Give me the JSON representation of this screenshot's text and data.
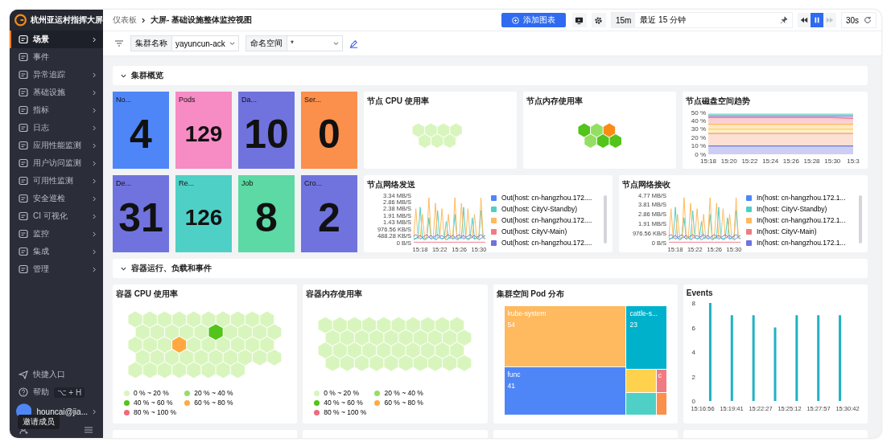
{
  "sidebar": {
    "title": "杭州亚运村指挥大屏",
    "items": [
      {
        "label": "场景",
        "selected": true,
        "submenu": true
      },
      {
        "label": "事件",
        "selected": false,
        "submenu": false
      },
      {
        "label": "异常追踪",
        "selected": false,
        "submenu": true
      },
      {
        "label": "基础设施",
        "selected": false,
        "submenu": true
      },
      {
        "label": "指标",
        "selected": false,
        "submenu": true
      },
      {
        "label": "日志",
        "selected": false,
        "submenu": true
      },
      {
        "label": "应用性能监测",
        "selected": false,
        "submenu": true
      },
      {
        "label": "用户访问监测",
        "selected": false,
        "submenu": true
      },
      {
        "label": "可用性监测",
        "selected": false,
        "submenu": true
      },
      {
        "label": "安全巡检",
        "selected": false,
        "submenu": true
      },
      {
        "label": "CI 可视化",
        "selected": false,
        "submenu": true
      },
      {
        "label": "监控",
        "selected": false,
        "submenu": true
      },
      {
        "label": "集成",
        "selected": false,
        "submenu": true
      },
      {
        "label": "管理",
        "selected": false,
        "submenu": true
      }
    ],
    "shortcut": "快捷入口",
    "help": "帮助",
    "help_keys": "⌥ + H",
    "user": "houncai@jia...",
    "tooltip": "邀请成员"
  },
  "header": {
    "breadcrumb": "仪表板",
    "title": "大屏- 基础设施整体监控视图",
    "add_button": "添加图表",
    "range_short": "15m",
    "range": "最近 15 分钟",
    "playback": [
      {
        "kind": "rewind",
        "selected": false,
        "disabled": false
      },
      {
        "kind": "pause",
        "selected": true,
        "disabled": false
      },
      {
        "kind": "forward",
        "selected": false,
        "disabled": true
      }
    ],
    "interval": "30s"
  },
  "filters": [
    {
      "label": "集群名称",
      "value": "yayuncun-ack"
    },
    {
      "label": "命名空间",
      "value": "*"
    }
  ],
  "sections": [
    {
      "title": "集群概览",
      "expanded": true
    },
    {
      "title": "容器运行、负载和事件",
      "expanded": true
    }
  ],
  "stats": [
    {
      "label": "No...",
      "value": "4",
      "color": "#4e86f8"
    },
    {
      "label": "Pods",
      "value": "129",
      "color": "#f78bc4"
    },
    {
      "label": "Da...",
      "value": "10",
      "color": "#7073de"
    },
    {
      "label": "Ser...",
      "value": "0",
      "color": "#fb8f4c"
    },
    {
      "label": "De...",
      "value": "31",
      "color": "#7073de"
    },
    {
      "label": "Re...",
      "value": "126",
      "color": "#4fd0c6"
    },
    {
      "label": "Job",
      "value": "8",
      "color": "#5cd9a4"
    },
    {
      "label": "Cro...",
      "value": "2",
      "color": "#7073de"
    }
  ],
  "node_cpu": {
    "title": "节点 CPU 使用率",
    "hexes": [
      {
        "color": "#d9f5be"
      },
      {
        "color": "#d9f5be"
      },
      {
        "color": "#d9f5be"
      },
      {
        "color": "#d9f5be"
      },
      {
        "color": "#d9f5be"
      },
      {
        "color": "#d9f5be"
      },
      {
        "color": "#d9f5be"
      }
    ]
  },
  "node_memory": {
    "title": "节点内存使用率",
    "hexes": [
      {
        "color": "#52c41a"
      },
      {
        "color": "#95de64"
      },
      {
        "color": "#fa8c16"
      },
      {
        "color": "#95de64"
      },
      {
        "color": "#52c41a"
      },
      {
        "color": "#52c41a"
      }
    ]
  },
  "disk_trend": {
    "title": "节点磁盘空间趋势",
    "chart_data": {
      "type": "area",
      "categories": [
        "15:18",
        "15:20",
        "15:22",
        "15:24",
        "15:26",
        "15:28",
        "15:30",
        "15:3"
      ],
      "ylim": [
        0,
        50
      ],
      "yticks": [
        {
          "value": 0,
          "label": "0 %"
        },
        {
          "value": 10,
          "label": "10 %"
        },
        {
          "value": 20,
          "label": "20 %"
        },
        {
          "value": 30,
          "label": "30 %"
        },
        {
          "value": 40,
          "label": "40 %"
        },
        {
          "value": 50,
          "label": "50 %"
        }
      ],
      "series": [
        {
          "color": "#6fd6c8",
          "values": [
            48,
            48,
            48,
            48,
            48,
            48,
            48,
            48
          ]
        },
        {
          "color": "#9a8fe2",
          "values": [
            46,
            46,
            46,
            46,
            46,
            46,
            46,
            46
          ]
        },
        {
          "color": "#f07c82",
          "values": [
            44,
            44,
            44,
            44,
            44,
            44,
            44,
            43
          ]
        },
        {
          "color": "#ffb95e",
          "values": [
            36,
            36,
            36,
            36,
            36,
            36,
            36,
            36
          ]
        },
        {
          "color": "#ffd666",
          "values": [
            30,
            30,
            30,
            30,
            30,
            30,
            30,
            30
          ]
        },
        {
          "color": "#f4a582",
          "values": [
            25,
            25,
            25,
            25,
            25,
            25,
            25,
            25
          ]
        },
        {
          "color": "#6f73df",
          "values": [
            10,
            10,
            10,
            10,
            10,
            10,
            10,
            10
          ]
        }
      ]
    }
  },
  "net_send": {
    "title": "节点网络发送",
    "y_labels": [
      "3.34 MB/S",
      "2.86 MB/S",
      "2.38 MB/S",
      "1.91 MB/S",
      "1.43 MB/S",
      "976.56 KB/S",
      "488.28 KB/S",
      "0 B/S"
    ],
    "x_labels": [
      "15:18",
      "15:22",
      "15:26",
      "15:30"
    ],
    "legend": [
      {
        "name": "Out(host: cn-hangzhou.172....",
        "color": "#4e86f8"
      },
      {
        "name": "Out(host: CityV-Standby)",
        "color": "#4fd0c6"
      },
      {
        "name": "Out(host: cn-hangzhou.172....",
        "color": "#ffb95e"
      },
      {
        "name": "Out(host: CityV-Main)",
        "color": "#f07c82"
      },
      {
        "name": "Out(host: cn-hangzhou.172....",
        "color": "#6f73df"
      }
    ]
  },
  "net_receive": {
    "title": "节点网络接收",
    "y_labels": [
      "4.77 MB/S",
      "3.81 MB/S",
      "2.86 MB/S",
      "1.91 MB/S",
      "976.56 KB/S",
      "0 B/S"
    ],
    "x_labels": [
      "15:18",
      "15:22",
      "15:26",
      "15:30"
    ],
    "legend": [
      {
        "name": "In(host: cn-hangzhou.172.1...",
        "color": "#4e86f8"
      },
      {
        "name": "In(host: CityV-Standby)",
        "color": "#4fd0c6"
      },
      {
        "name": "In(host: cn-hangzhou.172.1...",
        "color": "#ffb95e"
      },
      {
        "name": "In(host: CityV-Main)",
        "color": "#f07c82"
      },
      {
        "name": "In(host: cn-hangzhou.172.1...",
        "color": "#6f73df"
      }
    ]
  },
  "container_cpu": {
    "title": "容器 CPU 使用率",
    "hexes": [
      {
        "color": "#d9f5be"
      },
      {
        "color": "#d9f5be"
      },
      {
        "color": "#d9f5be"
      },
      {
        "color": "#d9f5be"
      },
      {
        "color": "#d9f5be"
      },
      {
        "color": "#d9f5be"
      },
      {
        "color": "#d9f5be"
      },
      {
        "color": "#d9f5be"
      },
      {
        "color": "#d9f5be"
      },
      {
        "color": "#d9f5be"
      },
      {
        "color": "#d9f5be"
      },
      {
        "color": "#d9f5be"
      },
      {
        "color": "#d9f5be"
      },
      {
        "color": "#d9f5be"
      },
      {
        "color": "#d9f5be"
      },
      {
        "color": "#52c41a"
      },
      {
        "color": "#d9f5be"
      },
      {
        "color": "#d9f5be"
      },
      {
        "color": "#d9f5be"
      },
      {
        "color": "#d9f5be"
      },
      {
        "color": "#d9f5be"
      },
      {
        "color": "#d9f5be"
      },
      {
        "color": "#d9f5be"
      },
      {
        "color": "#ffa940"
      },
      {
        "color": "#d9f5be"
      },
      {
        "color": "#d9f5be"
      },
      {
        "color": "#d9f5be"
      },
      {
        "color": "#d9f5be"
      },
      {
        "color": "#d9f5be"
      },
      {
        "color": "#d9f5be"
      },
      {
        "color": "#d9f5be"
      },
      {
        "color": "#d9f5be"
      },
      {
        "color": "#d9f5be"
      },
      {
        "color": "#d9f5be"
      },
      {
        "color": "#d9f5be"
      },
      {
        "color": "#d9f5be"
      },
      {
        "color": "#d9f5be"
      },
      {
        "color": "#d9f5be"
      },
      {
        "color": "#d9f5be"
      },
      {
        "color": "#d9f5be"
      },
      {
        "color": "#d9f5be"
      },
      {
        "color": "#d9f5be"
      },
      {
        "color": "#d9f5be"
      },
      {
        "color": "#d9f5be"
      },
      {
        "color": "#d9f5be"
      },
      {
        "color": "#d9f5be"
      },
      {
        "color": "#d9f5be"
      },
      {
        "color": "#d9f5be"
      }
    ],
    "legend": [
      {
        "label": "0 % ~ 20 %",
        "color": "#d9f5be"
      },
      {
        "label": "20 % ~ 40 %",
        "color": "#95de64"
      },
      {
        "label": "40 % ~ 60 %",
        "color": "#52c41a"
      },
      {
        "label": "60 % ~ 80 %",
        "color": "#ffa940"
      },
      {
        "label": "80 % ~ 100 %",
        "color": "#f06a7d"
      }
    ]
  },
  "container_memory": {
    "title": "容器内存使用率",
    "hexes": [
      {
        "color": "#d9f5be"
      },
      {
        "color": "#d9f5be"
      },
      {
        "color": "#d9f5be"
      },
      {
        "color": "#d9f5be"
      },
      {
        "color": "#d9f5be"
      },
      {
        "color": "#d9f5be"
      },
      {
        "color": "#d9f5be"
      },
      {
        "color": "#d9f5be"
      },
      {
        "color": "#d9f5be"
      },
      {
        "color": "#d9f5be"
      },
      {
        "color": "#d9f5be"
      },
      {
        "color": "#d9f5be"
      },
      {
        "color": "#d9f5be"
      },
      {
        "color": "#d9f5be"
      },
      {
        "color": "#d9f5be"
      },
      {
        "color": "#d9f5be"
      },
      {
        "color": "#d9f5be"
      },
      {
        "color": "#d9f5be"
      },
      {
        "color": "#d9f5be"
      },
      {
        "color": "#d9f5be"
      },
      {
        "color": "#d9f5be"
      },
      {
        "color": "#d9f5be"
      },
      {
        "color": "#d9f5be"
      },
      {
        "color": "#d9f5be"
      },
      {
        "color": "#d9f5be"
      },
      {
        "color": "#d9f5be"
      },
      {
        "color": "#d9f5be"
      },
      {
        "color": "#d9f5be"
      },
      {
        "color": "#d9f5be"
      },
      {
        "color": "#d9f5be"
      },
      {
        "color": "#d9f5be"
      },
      {
        "color": "#d9f5be"
      },
      {
        "color": "#d9f5be"
      },
      {
        "color": "#d9f5be"
      },
      {
        "color": "#d9f5be"
      },
      {
        "color": "#d9f5be"
      },
      {
        "color": "#d9f5be"
      },
      {
        "color": "#d9f5be"
      },
      {
        "color": "#d9f5be"
      },
      {
        "color": "#d9f5be"
      }
    ],
    "legend": [
      {
        "label": "0 % ~ 20 %",
        "color": "#d9f5be"
      },
      {
        "label": "20 % ~ 40 %",
        "color": "#95de64"
      },
      {
        "label": "40 % ~ 60 %",
        "color": "#52c41a"
      },
      {
        "label": "60 % ~ 80 %",
        "color": "#ffa940"
      },
      {
        "label": "80 % ~ 100 %",
        "color": "#f06a7d"
      }
    ]
  },
  "pod_distribution": {
    "title": "集群空间 Pod 分布",
    "cells": [
      {
        "name": "kube-system",
        "value": "54",
        "color": "#ffb95e"
      },
      {
        "name": "func",
        "value": "41",
        "color": "#4e86f8"
      },
      {
        "name": "cattle-s...",
        "value": "23",
        "color": "#00b1cc"
      },
      {
        "color": "#ffd24d"
      },
      {
        "name": "c",
        "color": "#f07c82"
      },
      {
        "color": "#4fd0c6"
      },
      {
        "color": "#fb8f4c"
      }
    ]
  },
  "events": {
    "title": "Events",
    "x_labels": [
      "15:16:56",
      "15:19:41",
      "15:22:27",
      "15:25:12",
      "15:27:57",
      "15:30:42"
    ],
    "chart_data": {
      "type": "bar",
      "categories": [
        null,
        null,
        null,
        null,
        null,
        null,
        null
      ],
      "ylim": [
        0,
        8
      ],
      "yticks": [
        0,
        2,
        4,
        6,
        8
      ],
      "series": [
        {
          "color": "#1fb2c6",
          "values": [
            8,
            7,
            7,
            6,
            7,
            7,
            7
          ]
        }
      ]
    }
  }
}
